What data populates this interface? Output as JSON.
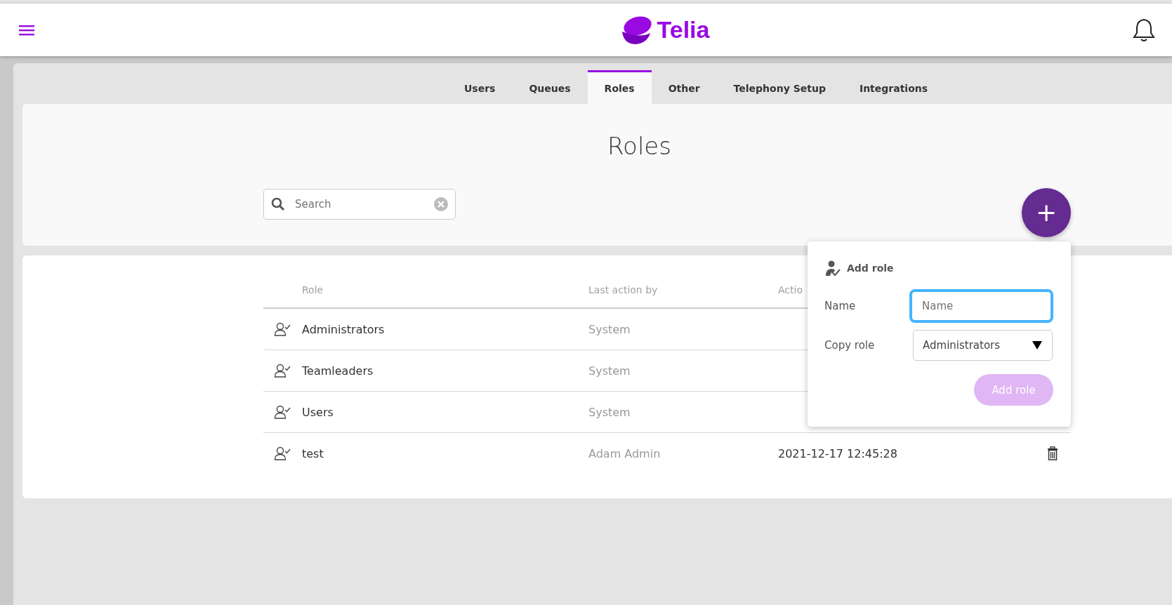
{
  "header": {
    "logo_text": "Telia"
  },
  "tabs": [
    {
      "label": "Users",
      "selected": false
    },
    {
      "label": "Queues",
      "selected": false
    },
    {
      "label": "Roles",
      "selected": true
    },
    {
      "label": "Other",
      "selected": false
    },
    {
      "label": "Telephony Setup",
      "selected": false
    },
    {
      "label": "Integrations",
      "selected": false
    }
  ],
  "page_title": "Roles",
  "search": {
    "placeholder": "Search"
  },
  "add_button": {
    "label": "+"
  },
  "table": {
    "columns": [
      "Role",
      "Last action by",
      "Actio"
    ],
    "rows": [
      {
        "role": "Administrators",
        "last_action_by": "System"
      },
      {
        "role": "Teamleaders",
        "last_action_by": "System"
      },
      {
        "role": "Users",
        "last_action_by": "System"
      },
      {
        "role": "test",
        "last_action_by": "Adam Admin",
        "action_time": "2021-12-17 12:45:28",
        "deletable": true
      }
    ]
  },
  "add_role_popup": {
    "title": "Add role",
    "name_label": "Name",
    "name_placeholder": "Name",
    "copy_label": "Copy role",
    "copy_value": "Administrators",
    "submit_label": "Add role",
    "submit_disabled": true
  }
}
